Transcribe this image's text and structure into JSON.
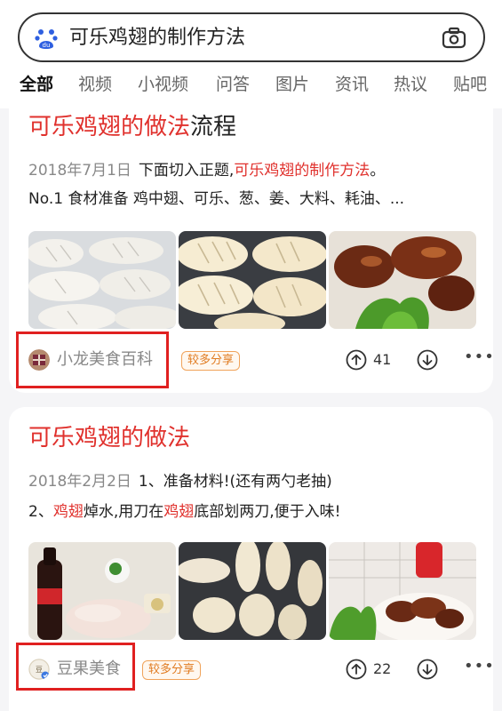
{
  "search": {
    "query": "可乐鸡翅的制作方法"
  },
  "tabs": [
    "全部",
    "视频",
    "小视频",
    "问答",
    "图片",
    "资讯",
    "热议",
    "贴吧"
  ],
  "results": [
    {
      "title_hl": "可乐鸡翅的做法",
      "title_plain": "流程",
      "date": "2018年7月1日",
      "line1_text": "下面切入正题,",
      "line1_hl": "可乐鸡翅的制作方法",
      "line1_end": "。",
      "line2": "No.1 食材准备 鸡中翅、可乐、葱、姜、大料、耗油、...",
      "source": "小龙美食百科",
      "badge": "较多分享",
      "upvotes": "41"
    },
    {
      "title_hl": "可乐鸡翅的做法",
      "date": "2018年2月2日",
      "line1_text": "1、准备材料!(还有两勺老抽)",
      "line2_a": "2、",
      "line2_hl1": "鸡翅",
      "line2_b": "焯水,用刀在",
      "line2_hl2": "鸡翅",
      "line2_c": "底部划两刀,便于入味!",
      "source": "豆果美食",
      "badge": "较多分享",
      "upvotes": "22"
    }
  ],
  "colors": {
    "accent": "#e0312d",
    "tab_active": "#2f6cf6",
    "highlight_box": "#e02020"
  }
}
